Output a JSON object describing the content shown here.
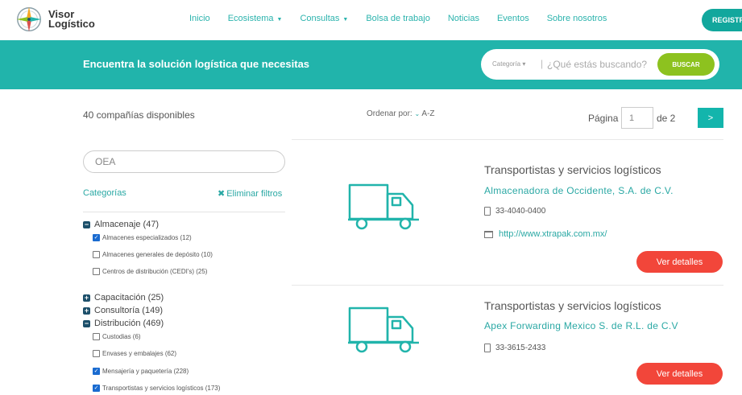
{
  "brand": {
    "line1": "Visor",
    "line2": "Logístico"
  },
  "nav": {
    "items": [
      {
        "label": "Inicio",
        "dropdown": false
      },
      {
        "label": "Ecosistema",
        "dropdown": true
      },
      {
        "label": "Consultas",
        "dropdown": true
      },
      {
        "label": "Bolsa de trabajo",
        "dropdown": false
      },
      {
        "label": "Noticias",
        "dropdown": false
      },
      {
        "label": "Eventos",
        "dropdown": false
      },
      {
        "label": "Sobre nosotros",
        "dropdown": false
      }
    ],
    "register_label": "REGISTRA"
  },
  "banner": {
    "title": "Encuentra la solución logística que necesitas",
    "category_label": "Categoría ▾",
    "search_placeholder": "¿Qué estás buscando?",
    "search_button": "BUSCAR"
  },
  "results": {
    "count_label": "40 compañías disponibles",
    "sort_label": "Ordenar por:",
    "sort_value": "A-Z",
    "page_label": "Página",
    "page_value": "1",
    "page_of": "de 2",
    "next_label": ">"
  },
  "filters": {
    "keyword": "OEA",
    "categories_label": "Categorías",
    "clear_label": "Eliminar filtros",
    "groups": [
      {
        "label": "Almacenaje (47)",
        "expanded": true,
        "items": [
          {
            "label": "Almacenes especializados (12)",
            "checked": true
          },
          {
            "label": "Almacenes generales de depósito (10)",
            "checked": false
          },
          {
            "label": "Centros de distribución (CEDI's) (25)",
            "checked": false
          }
        ]
      },
      {
        "label": "Capacitación (25)",
        "expanded": false,
        "items": []
      },
      {
        "label": "Consultoría (149)",
        "expanded": false,
        "items": []
      },
      {
        "label": "Distribución (469)",
        "expanded": true,
        "items": [
          {
            "label": "Custodias (6)",
            "checked": false
          },
          {
            "label": "Envases y embalajes (62)",
            "checked": false
          },
          {
            "label": "Mensajería y paquetería (228)",
            "checked": true
          },
          {
            "label": "Transportistas y servicios logísticos (173)",
            "checked": true
          }
        ]
      }
    ]
  },
  "companies": [
    {
      "category": "Transportistas y servicios logísticos",
      "name": "Almacenadora de Occidente, S.A. de C.V.",
      "phone": "33-4040-0400",
      "website": "http://www.xtrapak.com.mx/",
      "details_label": "Ver detalles"
    },
    {
      "category": "Transportistas y servicios logísticos",
      "name": "Apex Forwarding Mexico S. de R.L. de C.V",
      "phone": "33-3615-2433",
      "details_label": "Ver detalles"
    }
  ],
  "colors": {
    "teal": "#21b4ab",
    "green": "#8dc21f",
    "red": "#f2463a",
    "dark_teal": "#12a79d"
  }
}
